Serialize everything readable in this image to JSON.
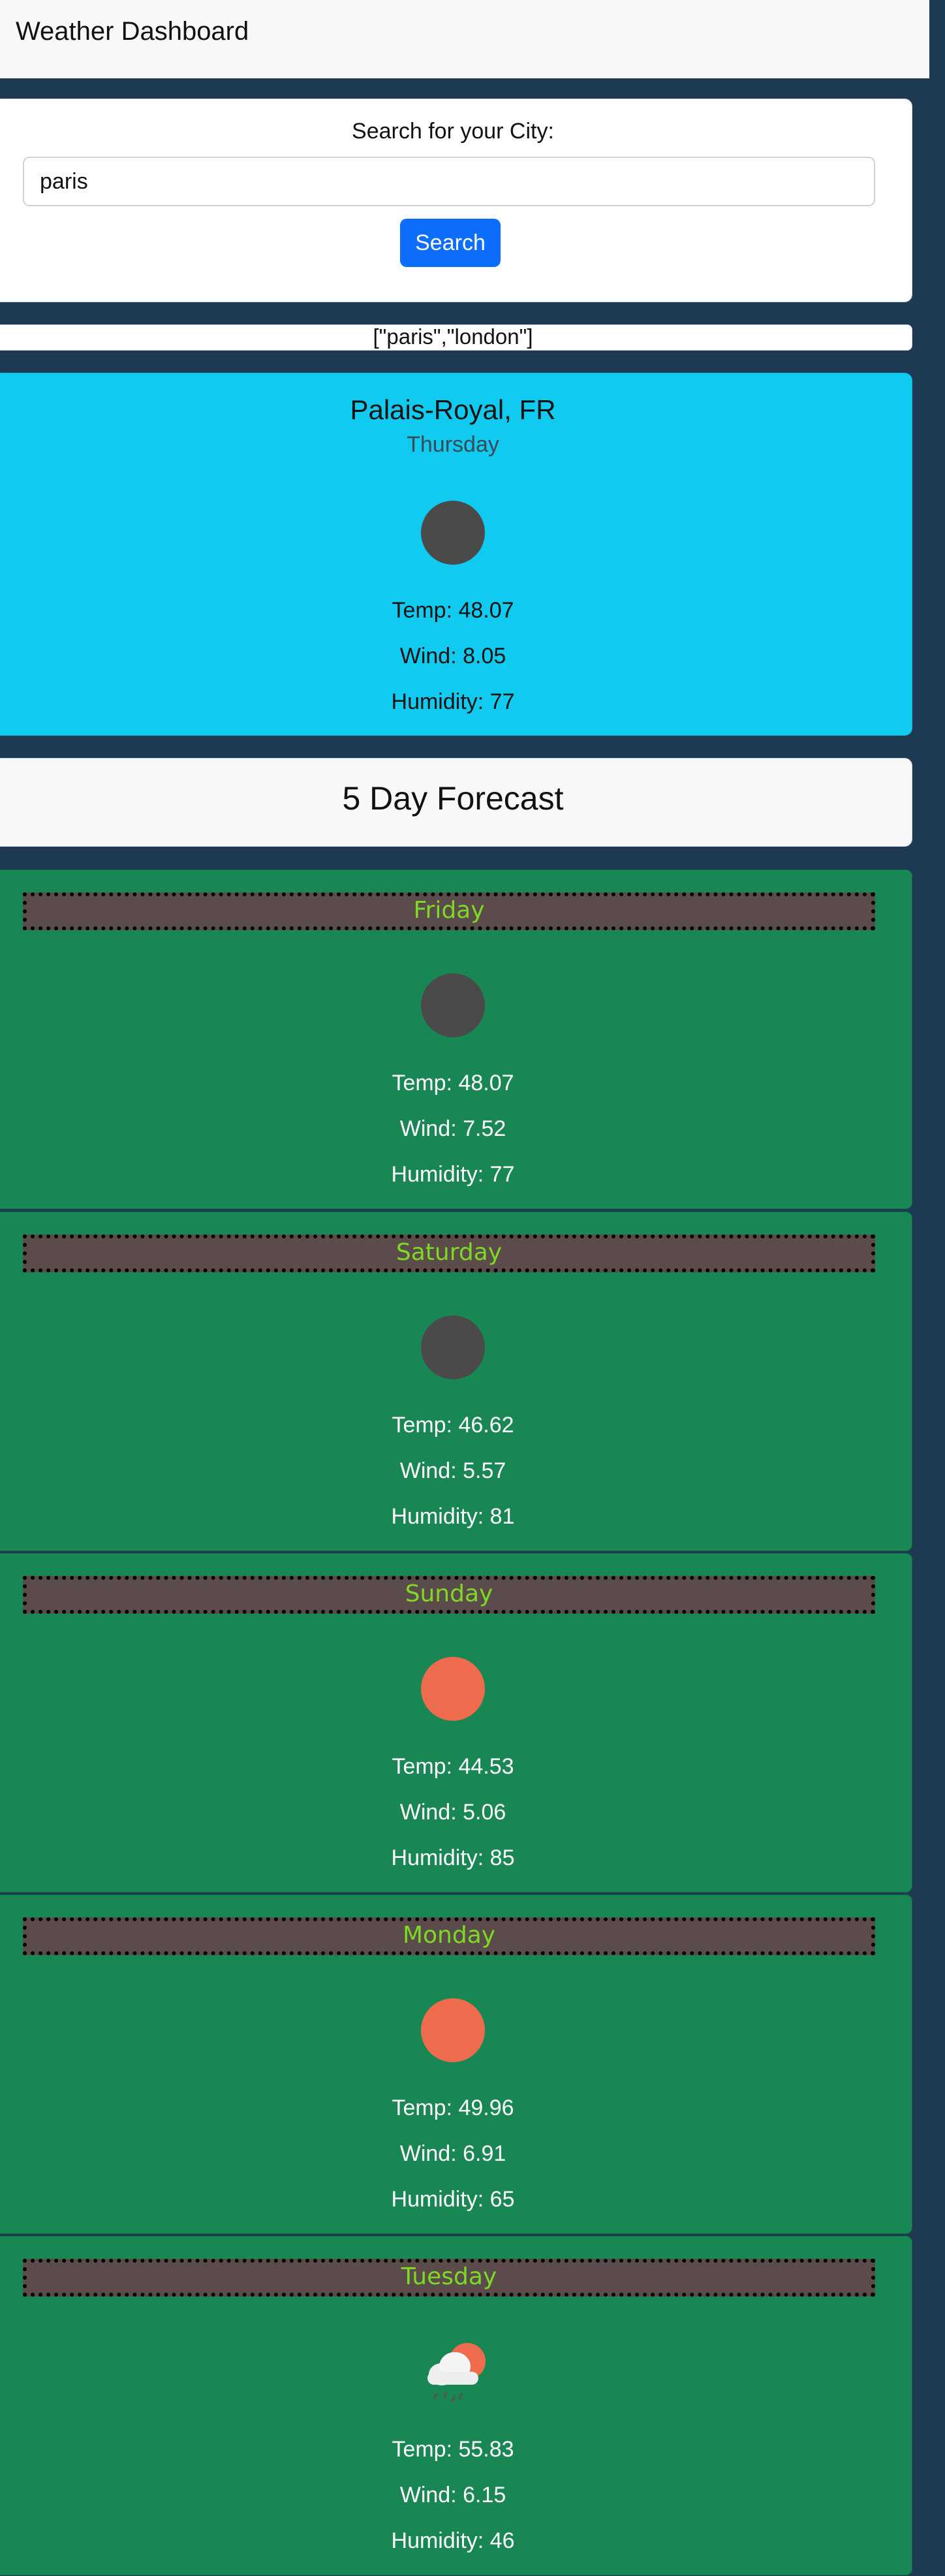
{
  "navbar": {
    "title": "Weather Dashboard"
  },
  "search": {
    "label": "Search for your City:",
    "value": "paris",
    "button_label": "Search"
  },
  "history": {
    "text": "[\"paris\",\"london\"]"
  },
  "current": {
    "city": "Palais-Royal, FR",
    "day": "Thursday",
    "icon": "dark-circle-icon",
    "icon_color": "#4a4a4a",
    "temp": "Temp: 48.07",
    "wind": "Wind: 8.05",
    "humidity": "Humidity: 77"
  },
  "forecast": {
    "title": "5 Day Forecast",
    "days": [
      {
        "day": "Friday",
        "icon": "dark-circle-icon",
        "icon_color": "#4a4a4a",
        "temp": "Temp: 48.07",
        "wind": "Wind: 7.52",
        "humidity": "Humidity: 77"
      },
      {
        "day": "Saturday",
        "icon": "dark-circle-icon",
        "icon_color": "#4a4a4a",
        "temp": "Temp: 46.62",
        "wind": "Wind: 5.57",
        "humidity": "Humidity: 81"
      },
      {
        "day": "Sunday",
        "icon": "sun-icon",
        "icon_color": "#ee6c4d",
        "temp": "Temp: 44.53",
        "wind": "Wind: 5.06",
        "humidity": "Humidity: 85"
      },
      {
        "day": "Monday",
        "icon": "sun-icon",
        "icon_color": "#ee6c4d",
        "temp": "Temp: 49.96",
        "wind": "Wind: 6.91",
        "humidity": "Humidity: 65"
      },
      {
        "day": "Tuesday",
        "icon": "rain-cloud-sun-icon",
        "icon_color": "#ee6c4d",
        "temp": "Temp: 55.83",
        "wind": "Wind: 6.15",
        "humidity": "Humidity: 46"
      }
    ]
  }
}
